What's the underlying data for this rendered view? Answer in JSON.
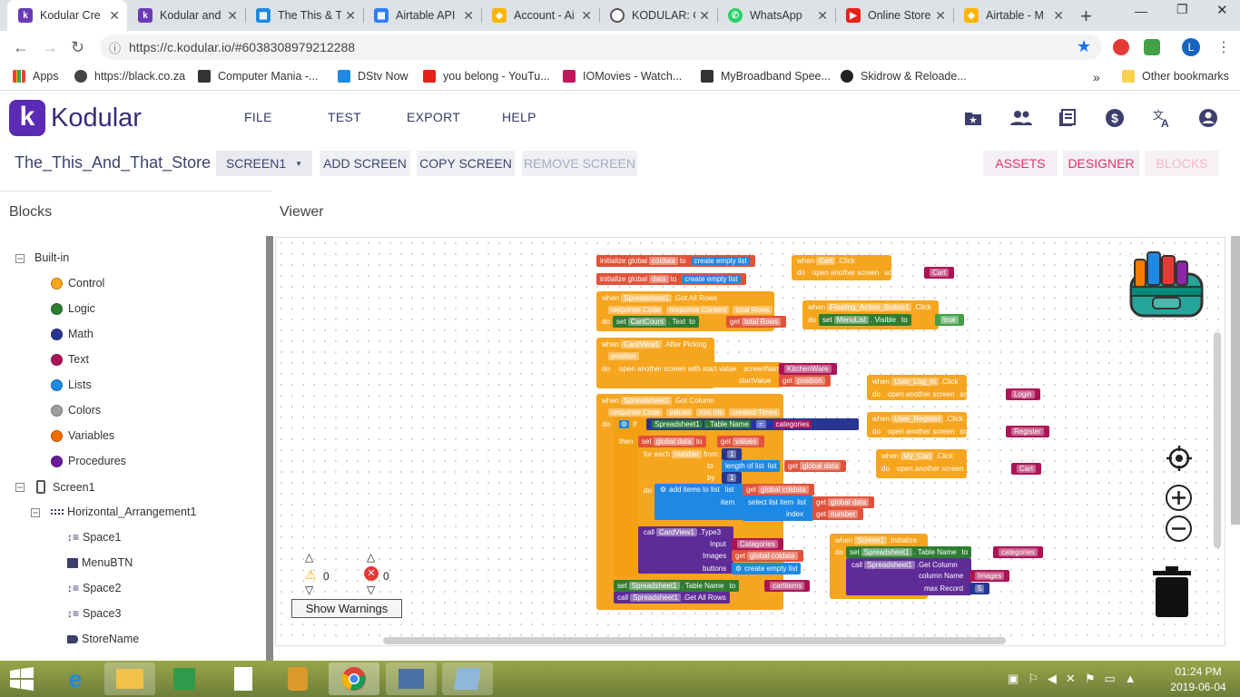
{
  "browser": {
    "tabs": [
      {
        "title": "Kodular Cre",
        "color": "#6a3bb5",
        "glyph": "k"
      },
      {
        "title": "Kodular and",
        "color": "#6a3bb5",
        "glyph": "k"
      },
      {
        "title": "The This & T",
        "color": "#1e88e5",
        "glyph": "▦"
      },
      {
        "title": "Airtable API",
        "color": "#2d7ff9",
        "glyph": "▦"
      },
      {
        "title": "Account - Ai",
        "color": "#fcb400",
        "glyph": "◆"
      },
      {
        "title": "KODULAR: C",
        "color": "#555555",
        "glyph": "◌"
      },
      {
        "title": "WhatsApp",
        "color": "#25d366",
        "glyph": "✆"
      },
      {
        "title": "Online Store",
        "color": "#e62117",
        "glyph": "▶"
      },
      {
        "title": "Airtable - M",
        "color": "#fcb400",
        "glyph": "◆"
      }
    ],
    "new_tab": "+",
    "url": "https://c.kodular.io/#6038308979212288",
    "bookmarks": [
      {
        "label": "Apps",
        "color": "#e94235"
      },
      {
        "label": "https://black.co.za",
        "color": "#444444"
      },
      {
        "label": "Computer Mania -...",
        "color": "#333333"
      },
      {
        "label": "DStv Now",
        "color": "#1e88e5"
      },
      {
        "label": "you belong - YouTu...",
        "color": "#e62117"
      },
      {
        "label": "IOMovies - Watch...",
        "color": "#c2185b"
      },
      {
        "label": "MyBroadband Spee...",
        "color": "#333333"
      },
      {
        "label": "Skidrow & Reloade...",
        "color": "#222222"
      }
    ],
    "more_bookmarks": "»",
    "other_bookmarks": "Other bookmarks",
    "profile_initial": "L"
  },
  "app": {
    "logo_letter": "k",
    "logo_text": "Kodular",
    "menu": [
      "FILE",
      "TEST",
      "EXPORT",
      "HELP"
    ],
    "project_name": "The_This_And_That_Store",
    "screen_select": "SCREEN1",
    "add_screen": "ADD SCREEN",
    "copy_screen": "COPY SCREEN",
    "remove_screen": "REMOVE SCREEN",
    "assets": "ASSETS",
    "designer": "DESIGNER",
    "blocks": "BLOCKS"
  },
  "sidebar": {
    "title": "Blocks",
    "builtin_label": "Built-in",
    "builtin": [
      {
        "label": "Control",
        "color": "#f6a51e"
      },
      {
        "label": "Logic",
        "color": "#2e7d32"
      },
      {
        "label": "Math",
        "color": "#283593"
      },
      {
        "label": "Text",
        "color": "#ad1457"
      },
      {
        "label": "Lists",
        "color": "#1e88e5"
      },
      {
        "label": "Colors",
        "color": "#9e9e9e"
      },
      {
        "label": "Variables",
        "color": "#ef6c00"
      },
      {
        "label": "Procedures",
        "color": "#6a1b9a"
      }
    ],
    "screen_label": "Screen1",
    "arrangement_label": "Horizontal_Arrangement1",
    "components": [
      "Space1",
      "MenuBTN",
      "Space2",
      "Space3",
      "StoreName"
    ]
  },
  "viewer": {
    "title": "Viewer",
    "warnings_count": "0",
    "errors_count": "0",
    "show_warnings": "Show Warnings"
  },
  "blocks": {
    "b1": "initialize global",
    "b1v": "coldata",
    "b1t": "to",
    "b1c": "create empty list",
    "b2": "initialize global",
    "b2v": "data",
    "b2t": "to",
    "b2c": "create empty list",
    "b3": "when",
    "b3c": "Spreadsheet1",
    "b3e": ".Got All Rows",
    "b3p1": "response Code",
    "b3p2": "response Content",
    "b3p3": "total Rows",
    "b3d": "do",
    "b3s": "set",
    "b3sc": "CartCount",
    "b3sp": ". Text",
    "b3st": "to",
    "b3g": "get",
    "b3gv": "total Rows",
    "b4": "when",
    "b4c": "CardView1",
    "b4e": ".After Picking",
    "b4p": "position",
    "b4d": "do",
    "b4a": "open another screen with start value",
    "b4sn": "screenName",
    "b4sv": "KitchenWare",
    "b4st": "startValue",
    "b4g": "get",
    "b4gv": "position",
    "b5": "when",
    "b5c": "Spreadsheet1",
    "b5e": ".Got Column",
    "b5p1": "response Code",
    "b5p2": "values",
    "b5p3": "row Ids",
    "b5p4": "created Times",
    "b5d": "do",
    "b5if": "if",
    "b5ic": "Spreadsheet1",
    "b5ip": ". Table Name",
    "b5eq": "=",
    "b5iv": "categories",
    "b5then": "then",
    "b5set": "set",
    "b5sv": "global data",
    "b5to": "to",
    "b5g": "get",
    "b5gv": "values",
    "b5for": "for each",
    "b5fv": "number",
    "b5from": "from",
    "b5f1": "1",
    "b5fto": "to",
    "b5len": "length of list",
    "b5list": "list",
    "b5g2": "get",
    "b5g2v": "global data",
    "b5by": "by",
    "b5b1": "1",
    "b5do": "do",
    "b5add": "add items to list",
    "b5al": "list",
    "b5ag": "get",
    "b5agv": "global coldata",
    "b5item": "item",
    "b5sel": "select list item",
    "b5sl": "list",
    "b5sg": "get",
    "b5sgv": "global data",
    "b5idx": "index",
    "b5ig": "get",
    "b5igv": "number",
    "b5call": "call",
    "b5cc": "CardView1",
    "b5cm": ".Type3",
    "b5in": "Input",
    "b5inv": "Catagories",
    "b5im": "Images",
    "b5img": "get",
    "b5imv": "global coldata",
    "b5bt": "buttons",
    "b5btc": "create empty list",
    "b5s2": "set",
    "b5s2c": "Spreadsheet1",
    "b5s2p": ". Table Name",
    "b5s2t": "to",
    "b5s2v": "cartitems",
    "b5c2": "call",
    "b5c2c": "Spreadsheet1",
    "b5c2m": ".Get All Rows",
    "c1": "when",
    "c1c": "Cart",
    "c1e": ".Click",
    "c1d": "do",
    "c1a": "open another screen",
    "c1s": "screenName",
    "c1v": "Cart",
    "c2": "when",
    "c2c": "Floating_Action_Button1",
    "c2e": ".Click",
    "c2d": "do",
    "c2s": "set",
    "c2sc": "MenuList",
    "c2sp": ". Visible",
    "c2t": "to",
    "c2v": "true",
    "c3": "when",
    "c3c": "User_Log_In",
    "c3e": ".Click",
    "c3d": "do",
    "c3a": "open another screen",
    "c3s": "screenName",
    "c3v": "Login",
    "c4": "when",
    "c4c": "User_Register",
    "c4e": ".Click",
    "c4d": "do",
    "c4a": "open another screen",
    "c4s": "screenName",
    "c4v": "Register",
    "c5": "when",
    "c5c": "My_Cart",
    "c5e": ".Click",
    "c5d": "do",
    "c5a": "open another screen",
    "c5s": "screenName",
    "c5v": "Cart",
    "c6": "when",
    "c6c": "Screen1",
    "c6e": ".Initialize",
    "c6d": "do",
    "c6s": "set",
    "c6sc": "Spreadsheet1",
    "c6sp": ". Table Name",
    "c6t": "to",
    "c6v": "categories",
    "c6call": "call",
    "c6cc": "Spreadsheet1",
    "c6cm": ".Get Column",
    "c6cn": "column Name",
    "c6cnv": "Images",
    "c6mr": "max Record",
    "c6mrv": "5"
  },
  "taskbar": {
    "time": "01:24 PM",
    "date": "2019-06-04"
  }
}
